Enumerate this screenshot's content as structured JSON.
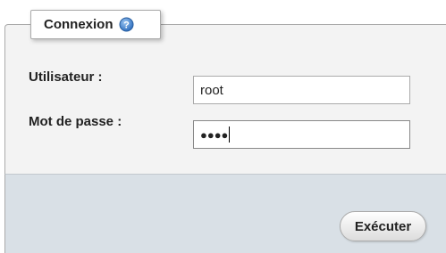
{
  "login": {
    "legend": "Connexion",
    "help_icon": "help-icon",
    "username_label": "Utilisateur :",
    "username_value": "root",
    "password_label": "Mot de passe :",
    "password_masked": "●●●●",
    "submit_label": "Exécuter"
  },
  "colors": {
    "fieldset_bg": "#f3f3f3",
    "footer_bg": "#d9e0e6",
    "help_icon_blue": "#3b78c4"
  }
}
